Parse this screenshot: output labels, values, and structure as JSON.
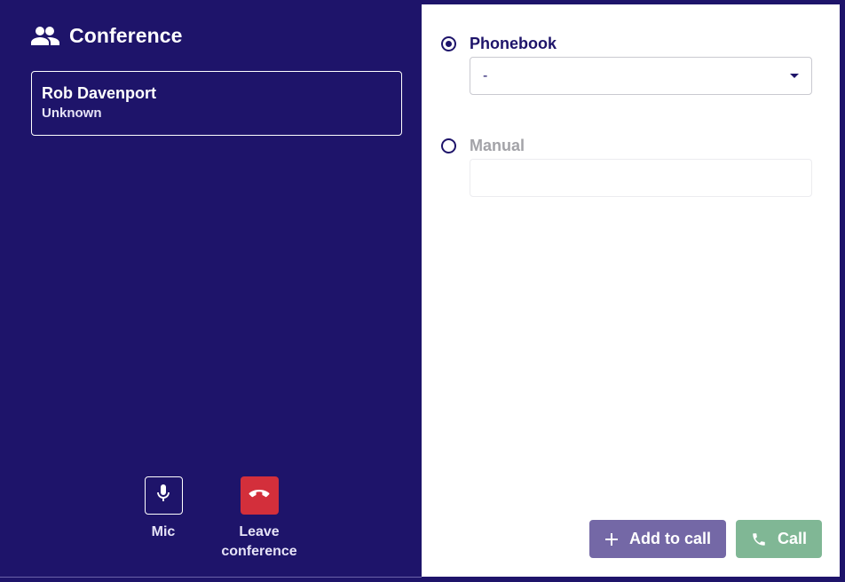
{
  "conference": {
    "title": "Conference",
    "icon": "group-icon",
    "participant": {
      "name": "Rob Davenport",
      "status": "Unknown"
    },
    "controls": {
      "mic_label": "Mic",
      "mic_icon": "microphone-icon",
      "leave_label": "Leave conference",
      "leave_icon": "hang-up-icon"
    }
  },
  "dial": {
    "phonebook": {
      "label": "Phonebook",
      "selected": true,
      "value": "-"
    },
    "manual": {
      "label": "Manual",
      "selected": false,
      "value": ""
    },
    "add_label": "Add to call",
    "add_icon": "plus-icon",
    "call_label": "Call",
    "call_icon": "phone-icon"
  },
  "colors": {
    "background": "#1e146a",
    "leave": "#d32f3b",
    "add": "#7468a6",
    "call": "#80b795"
  }
}
